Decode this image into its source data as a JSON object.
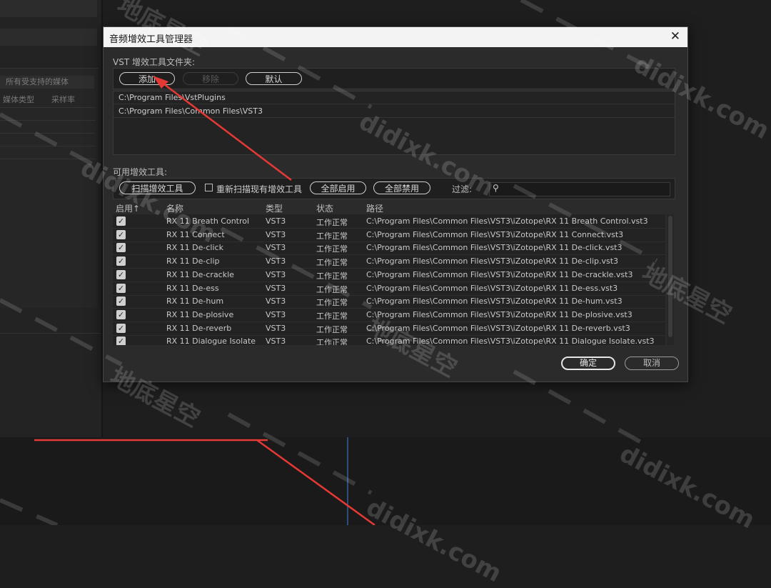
{
  "background": {
    "media_select": "所有受支持的媒体",
    "col_media_type": "媒体类型",
    "col_sample_rate": "采样率"
  },
  "dialog": {
    "title": "音频增效工具管理器",
    "close_icon": "close-icon",
    "vst_folder_label": "VST 增效工具文件夹:",
    "buttons": {
      "add": "添加",
      "remove": "移除",
      "default": "默认"
    },
    "folders": [
      "C:\\Program Files\\VstPlugins",
      "C:\\Program Files\\Common Files\\VST3"
    ],
    "available_label": "可用增效工具:",
    "scan_button": "扫描增效工具",
    "rescan_checkbox": "重新扫描现有增效工具",
    "enable_all": "全部启用",
    "disable_all": "全部禁用",
    "filter_label": "过滤:",
    "filter_value": "",
    "search_icon": "search-icon",
    "table": {
      "headers": {
        "enabled": "启用",
        "sort_indicator": "↑",
        "name": "名称",
        "type": "类型",
        "status": "状态",
        "path": "路径"
      },
      "rows": [
        {
          "enabled": true,
          "name": "RX 11 Breath Control",
          "type": "VST3",
          "status": "工作正常",
          "path": "C:\\Program Files\\Common Files\\VST3\\iZotope\\RX 11 Breath Control.vst3"
        },
        {
          "enabled": true,
          "name": "RX 11 Connect",
          "type": "VST3",
          "status": "工作正常",
          "path": "C:\\Program Files\\Common Files\\VST3\\iZotope\\RX 11 Connect.vst3"
        },
        {
          "enabled": true,
          "name": "RX 11 De-click",
          "type": "VST3",
          "status": "工作正常",
          "path": "C:\\Program Files\\Common Files\\VST3\\iZotope\\RX 11 De-click.vst3"
        },
        {
          "enabled": true,
          "name": "RX 11 De-clip",
          "type": "VST3",
          "status": "工作正常",
          "path": "C:\\Program Files\\Common Files\\VST3\\iZotope\\RX 11 De-clip.vst3"
        },
        {
          "enabled": true,
          "name": "RX 11 De-crackle",
          "type": "VST3",
          "status": "工作正常",
          "path": "C:\\Program Files\\Common Files\\VST3\\iZotope\\RX 11 De-crackle.vst3"
        },
        {
          "enabled": true,
          "name": "RX 11 De-ess",
          "type": "VST3",
          "status": "工作正常",
          "path": "C:\\Program Files\\Common Files\\VST3\\iZotope\\RX 11 De-ess.vst3"
        },
        {
          "enabled": true,
          "name": "RX 11 De-hum",
          "type": "VST3",
          "status": "工作正常",
          "path": "C:\\Program Files\\Common Files\\VST3\\iZotope\\RX 11 De-hum.vst3"
        },
        {
          "enabled": true,
          "name": "RX 11 De-plosive",
          "type": "VST3",
          "status": "工作正常",
          "path": "C:\\Program Files\\Common Files\\VST3\\iZotope\\RX 11 De-plosive.vst3"
        },
        {
          "enabled": true,
          "name": "RX 11 De-reverb",
          "type": "VST3",
          "status": "工作正常",
          "path": "C:\\Program Files\\Common Files\\VST3\\iZotope\\RX 11 De-reverb.vst3"
        },
        {
          "enabled": true,
          "name": "RX 11 Dialogue Isolate",
          "type": "VST3",
          "status": "工作正常",
          "path": "C:\\Program Files\\Common Files\\VST3\\iZotope\\RX 11 Dialogue Isolate.vst3"
        }
      ]
    },
    "ok": "确定",
    "cancel": "取消"
  },
  "watermark": {
    "latin": "didixk.com",
    "cjk": "地底星空"
  },
  "colors": {
    "annotation_arrow": "#e53935"
  }
}
